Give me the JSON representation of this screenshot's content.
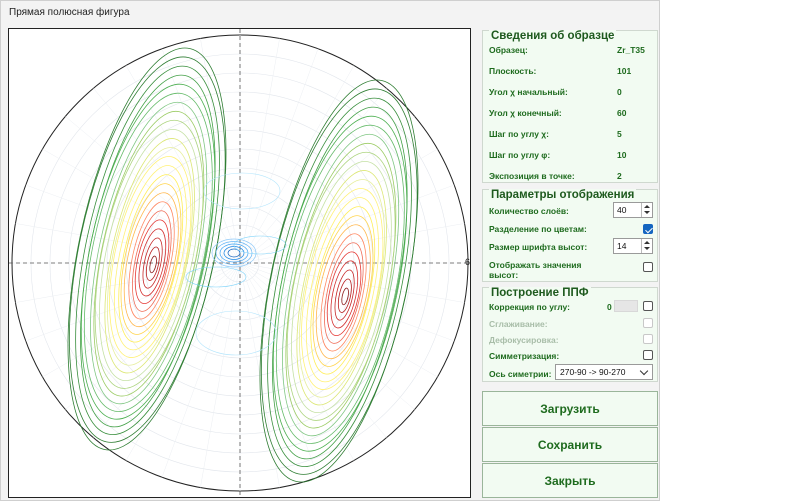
{
  "window": {
    "title": "Прямая полюсная фигура"
  },
  "plot": {
    "axis_label": "60"
  },
  "sample_info": {
    "title": "Сведения об образце",
    "rows": [
      {
        "label": "Образец:",
        "value": "Zr_T35"
      },
      {
        "label": "Плоскость:",
        "value": "101"
      },
      {
        "label": "Угол χ начальный:",
        "value": "0"
      },
      {
        "label": "Угол χ конечный:",
        "value": "60"
      },
      {
        "label": "Шаг по углу χ:",
        "value": "5"
      },
      {
        "label": "Шаг по углу φ:",
        "value": "10"
      },
      {
        "label": "Экспозиция в точке:",
        "value": "2"
      }
    ]
  },
  "display_params": {
    "title": "Параметры отображения",
    "layers_label": "Количество слоёв:",
    "layers_value": "40",
    "color_sep_label": "Разделение по цветам:",
    "color_sep_checked": true,
    "font_size_label": "Размер шрифта высот:",
    "font_size_value": "14",
    "show_heights_label_1": "Отображать значения",
    "show_heights_label_2": "высот:",
    "show_heights_checked": false
  },
  "ppf": {
    "title": "Построение ППФ",
    "angle_corr_label": "Коррекция по углу:",
    "angle_corr_value": "0",
    "smoothing_label": "Сглаживание:",
    "defocus_label": "Дефокусировка:",
    "symmetrization_label": "Симметризация:",
    "sym_axis_label": "Ось симетрии:",
    "sym_axis_value": "270-90 -> 90-270"
  },
  "buttons": {
    "load": "Загрузить",
    "save": "Сохранить",
    "close": "Закрыть"
  },
  "colors": {
    "accent_green": "#1e6b1e",
    "panel_bg": "#f2fbf2",
    "checkbox_blue": "#1565c0"
  }
}
